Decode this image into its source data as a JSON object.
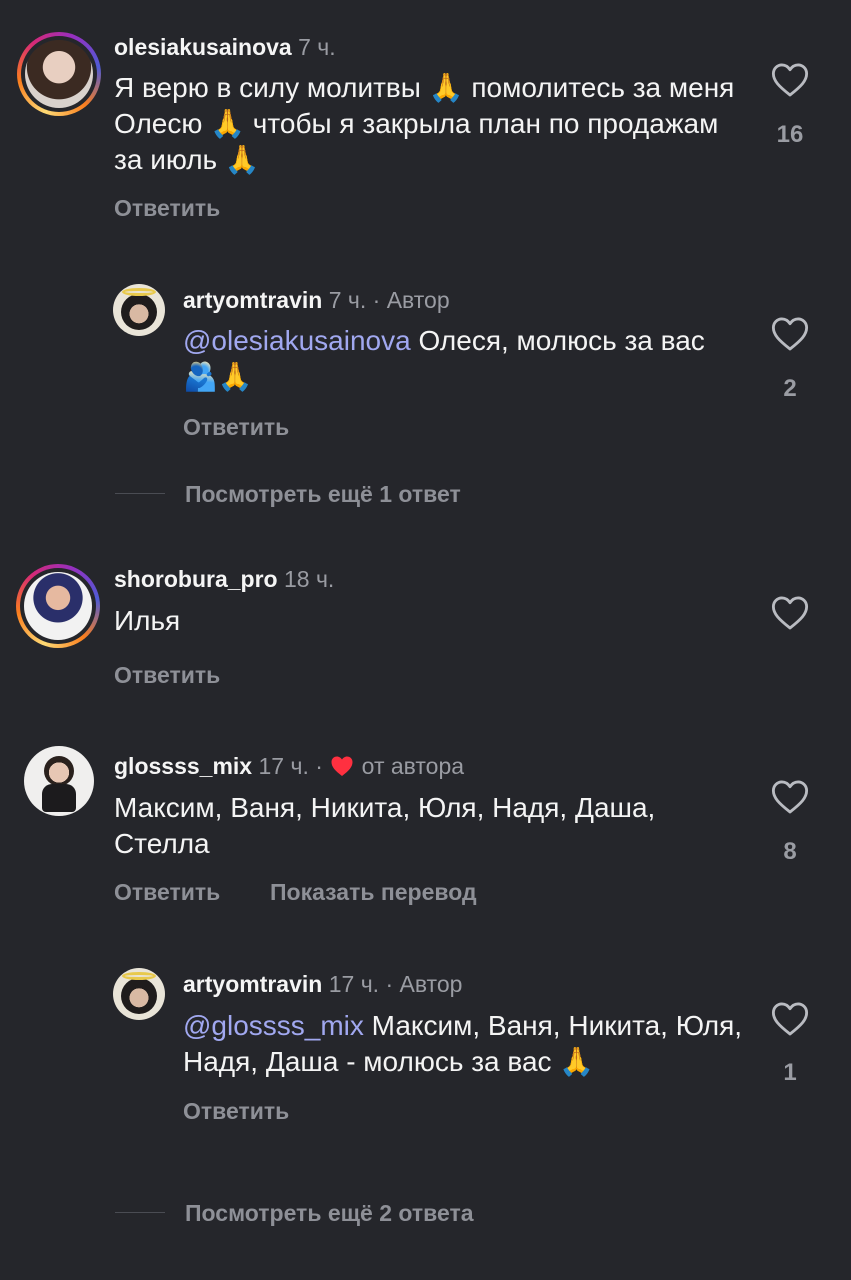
{
  "comments": [
    {
      "username": "olesiakusainova",
      "time": "7 ч.",
      "text": "Я верю в силу молитвы 🙏 помолитесь за меня Олесю 🙏 чтобы я закрыла план по продажам за июль 🙏",
      "reply_label": "Ответить",
      "likes": "16"
    },
    {
      "username": "artyomtravin",
      "time": "7 ч. · Автор",
      "mention": "@olesiakusainova",
      "text": " Олеся, молюсь за вас 🫂🙏",
      "reply_label": "Ответить",
      "likes": "2"
    },
    {
      "username": "shorobura_pro",
      "time": "18 ч.",
      "text": "Илья",
      "reply_label": "Ответить",
      "likes": ""
    },
    {
      "username": "glossss_mix",
      "time": "17 ч. ·",
      "liked_by_author": "от автора",
      "text": "Максим, Ваня, Никита, Юля, Надя, Даша, Стелла",
      "reply_label": "Ответить",
      "translate_label": "Показать перевод",
      "likes": "8"
    },
    {
      "username": "artyomtravin",
      "time": "17 ч. · Автор",
      "mention": "@glossss_mix",
      "text": " Максим, Ваня, Никита, Юля, Надя, Даша - молюсь за вас 🙏",
      "reply_label": "Ответить",
      "likes": "1"
    }
  ],
  "view_more": [
    "Посмотреть ещё 1 ответ",
    "Посмотреть ещё 2 ответа"
  ],
  "colors": {
    "background": "#25262b",
    "mention": "#a1a8f0",
    "meta": "#9a9ca3",
    "heart_author": "#ff3040"
  },
  "icons": {
    "like": "heart-outline-icon",
    "liked_by_author": "heart-filled-icon"
  }
}
